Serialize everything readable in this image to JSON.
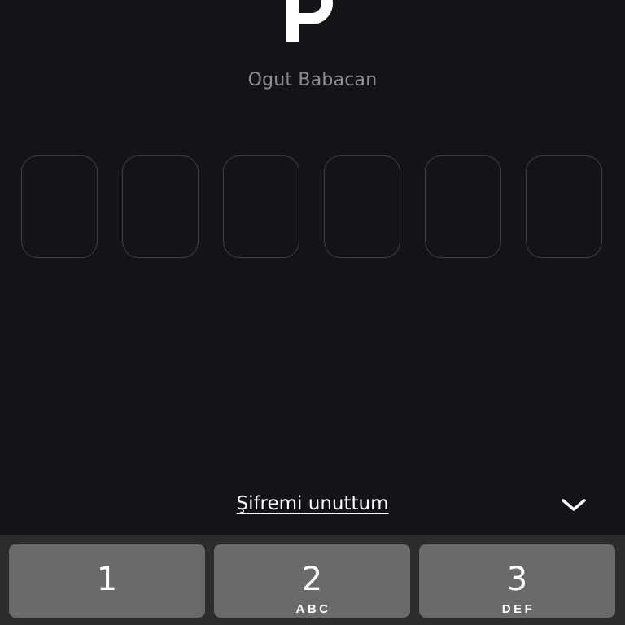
{
  "header": {
    "logo_icon": "papara-p-logo-icon",
    "user_name": "Ogut Babacan"
  },
  "pin": {
    "length": 6,
    "filled": 0
  },
  "actions": {
    "forgot_password": "Şifremi unuttum",
    "dismiss_icon": "chevron-down-icon"
  },
  "keypad": {
    "keys": [
      {
        "digit": "1",
        "letters": ""
      },
      {
        "digit": "2",
        "letters": "ABC"
      },
      {
        "digit": "3",
        "letters": "DEF"
      }
    ]
  },
  "colors": {
    "background": "#141418",
    "box_border": "#3d3d42",
    "muted_text": "#8e8e93",
    "key_background": "#6a6a6d",
    "keyboard_background": "#2c2c2e"
  }
}
